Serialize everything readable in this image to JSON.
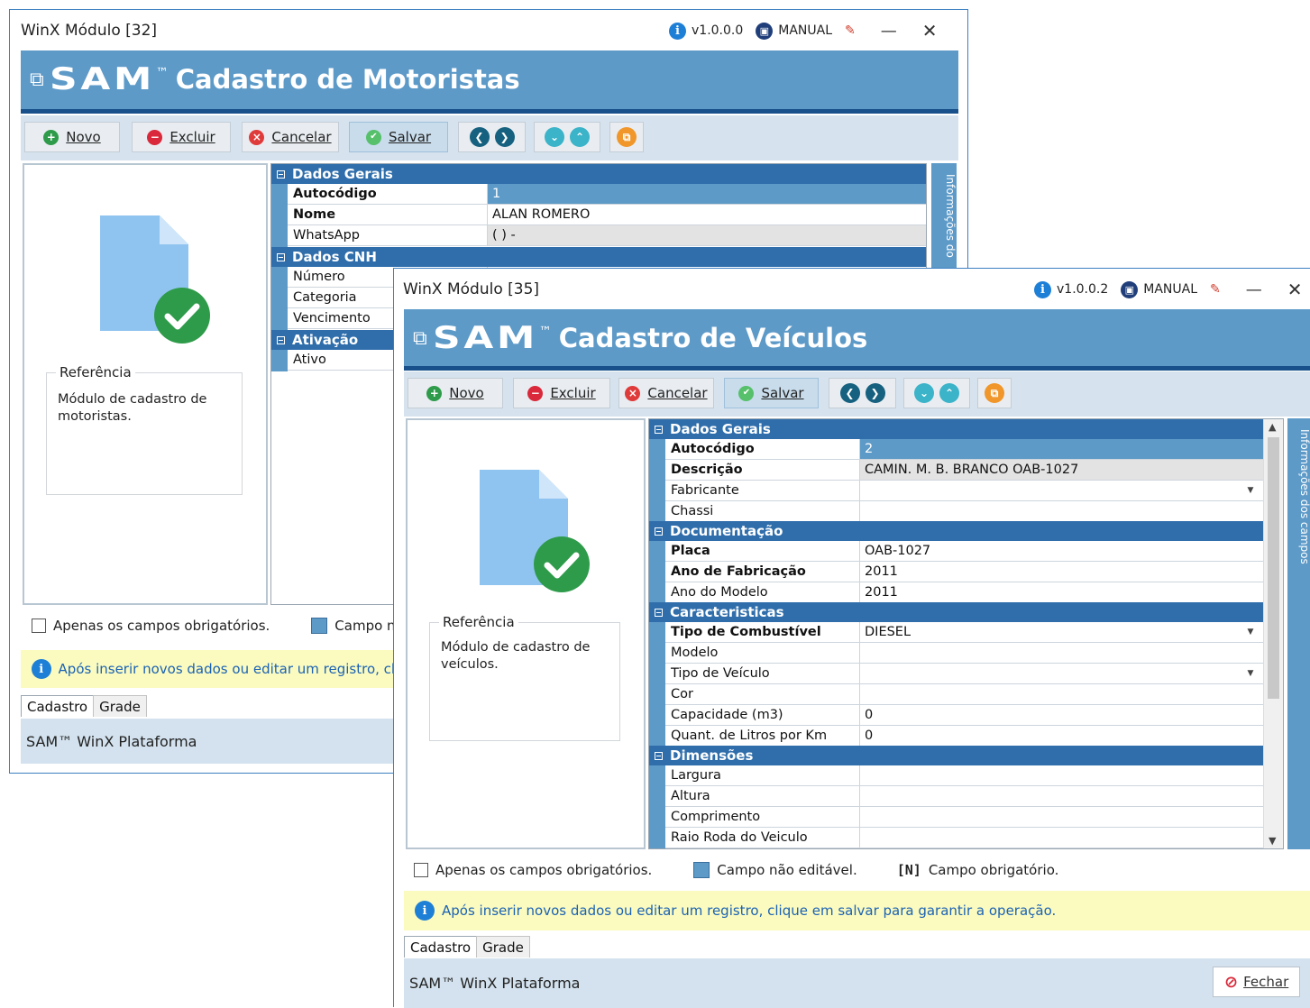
{
  "window1": {
    "title": "WinX Módulo [32]",
    "version": "v1.0.0.0",
    "manual": "MANUAL",
    "header_title": "Cadastro de Motoristas",
    "logo_text": "SAM",
    "tm": "™",
    "toolbar": {
      "novo": "Novo",
      "excluir": "Excluir",
      "cancelar": "Cancelar",
      "salvar": "Salvar"
    },
    "reference": {
      "legend": "Referência",
      "text": "Módulo de cadastro de motoristas."
    },
    "sections": [
      {
        "title": "Dados Gerais",
        "rows": [
          {
            "label": "Autocódigo",
            "value": "1"
          },
          {
            "label": "Nome",
            "value": "ALAN ROMERO"
          },
          {
            "label": "WhatsApp",
            "value": "( )   -"
          }
        ]
      },
      {
        "title": "Dados CNH",
        "rows": [
          {
            "label": "Número",
            "value": ""
          },
          {
            "label": "Categoria",
            "value": ""
          },
          {
            "label": "Vencimento",
            "value": ""
          }
        ]
      },
      {
        "title": "Ativação",
        "rows": [
          {
            "label": "Ativo",
            "value": ""
          }
        ]
      }
    ],
    "side_tab": "Informações do",
    "only_required": "Apenas os campos obrigatórios.",
    "non_editable": "Campo não e",
    "banner": "Após inserir novos dados ou editar um registro, cliqu",
    "tabs": [
      "Cadastro",
      "Grade"
    ],
    "footer": "SAM™ WinX Plataforma"
  },
  "window2": {
    "title": "WinX Módulo [35]",
    "version": "v1.0.0.2",
    "manual": "MANUAL",
    "header_title": "Cadastro de Veículos",
    "logo_text": "SAM",
    "tm": "™",
    "toolbar": {
      "novo": "Novo",
      "excluir": "Excluir",
      "cancelar": "Cancelar",
      "salvar": "Salvar"
    },
    "reference": {
      "legend": "Referência",
      "text": "Módulo de cadastro de veículos."
    },
    "sections": [
      {
        "title": "Dados Gerais",
        "rows": [
          {
            "label": "Autocódigo",
            "value": "2"
          },
          {
            "label": "Descrição",
            "value": "CAMIN. M. B. BRANCO OAB-1027"
          },
          {
            "label": "Fabricante",
            "value": ""
          },
          {
            "label": "Chassi",
            "value": ""
          }
        ]
      },
      {
        "title": "Documentação",
        "rows": [
          {
            "label": "Placa",
            "value": "OAB-1027"
          },
          {
            "label": "Ano de Fabricação",
            "value": "2011"
          },
          {
            "label": "Ano do Modelo",
            "value": "2011"
          }
        ]
      },
      {
        "title": "Caracteristicas",
        "rows": [
          {
            "label": "Tipo de Combustível",
            "value": "DIESEL"
          },
          {
            "label": "Modelo",
            "value": ""
          },
          {
            "label": "Tipo de Veículo",
            "value": ""
          },
          {
            "label": "Cor",
            "value": ""
          },
          {
            "label": "Capacidade (m3)",
            "value": "0"
          },
          {
            "label": "Quant. de Litros por Km",
            "value": "0"
          }
        ]
      },
      {
        "title": "Dimensões",
        "rows": [
          {
            "label": "Largura",
            "value": ""
          },
          {
            "label": "Altura",
            "value": ""
          },
          {
            "label": "Comprimento",
            "value": ""
          },
          {
            "label": "Raio Roda do Veiculo",
            "value": ""
          }
        ]
      }
    ],
    "side_tab": "Informações dos campos",
    "only_required": "Apenas os campos obrigatórios.",
    "non_editable": "Campo não editável.",
    "required_tag": "[N]",
    "required_text": "Campo obrigatório.",
    "banner": "Após inserir novos dados ou editar um registro, clique em salvar para garantir a operação.",
    "tabs": [
      "Cadastro",
      "Grade"
    ],
    "footer": "SAM™ WinX Plataforma",
    "close_button": "Fechar"
  },
  "colors": {
    "accent": "#5d9ac8",
    "section": "#2f6eab",
    "dark_bar": "#17508a",
    "banner_bg": "#fbfbbf"
  }
}
